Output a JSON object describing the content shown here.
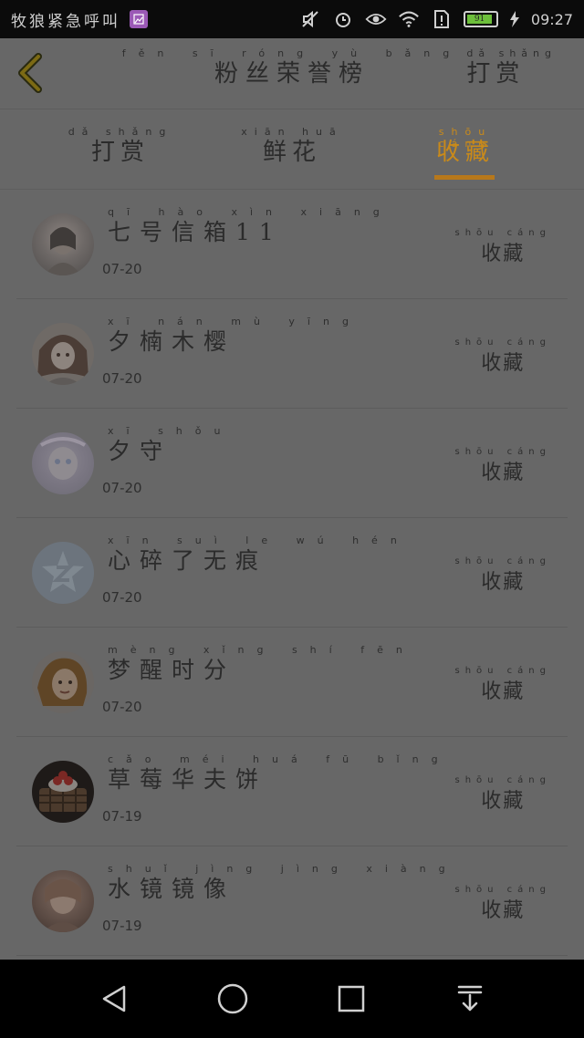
{
  "status_bar": {
    "app_text": "牧狼紧急呼叫",
    "time": "09:27",
    "battery_level": "91",
    "icons": [
      "gallery-icon",
      "mute-icon",
      "alarm-icon",
      "eye-icon",
      "wifi-icon",
      "sim-alert-icon",
      "battery-icon",
      "charging-icon"
    ]
  },
  "header": {
    "back_icon": "chevron-left-icon",
    "title_pinyin": "fěn sī róng yù bǎng",
    "title": "粉丝荣誉榜",
    "reward_pinyin": "dǎ shǎng",
    "reward_label": "打赏"
  },
  "tabs": [
    {
      "pinyin": "dǎ shǎng",
      "label": "打赏",
      "active": false
    },
    {
      "pinyin": "xiān huā",
      "label": "鲜花",
      "active": false
    },
    {
      "pinyin": "shōu cáng",
      "label": "收藏",
      "active": true
    }
  ],
  "rows": [
    {
      "name_pinyin": "qī hào xìn xiāng",
      "name": "七号信箱11",
      "date": "07-20",
      "action_pinyin": "shōu cáng",
      "action": "收藏"
    },
    {
      "name_pinyin": "xī nán mù yīng",
      "name": "夕楠木樱",
      "date": "07-20",
      "action_pinyin": "shōu cáng",
      "action": "收藏"
    },
    {
      "name_pinyin": "xī shǒu",
      "name": "夕守",
      "date": "07-20",
      "action_pinyin": "shōu cáng",
      "action": "收藏"
    },
    {
      "name_pinyin": "xīn suì le wú hén",
      "name": "心碎了无痕",
      "date": "07-20",
      "action_pinyin": "shōu cáng",
      "action": "收藏"
    },
    {
      "name_pinyin": "mèng xǐng shí fēn",
      "name": "梦醒时分",
      "date": "07-20",
      "action_pinyin": "shōu cáng",
      "action": "收藏"
    },
    {
      "name_pinyin": "cǎo méi huá fū bǐng",
      "name": "草莓华夫饼",
      "date": "07-19",
      "action_pinyin": "shōu cáng",
      "action": "收藏"
    },
    {
      "name_pinyin": "shuǐ jìng jìng xiàng",
      "name": "水镜镜像",
      "date": "07-19",
      "action_pinyin": "shōu cáng",
      "action": "收藏"
    }
  ],
  "navbar": {
    "icons": [
      "back-triangle-icon",
      "home-circle-icon",
      "recents-square-icon",
      "notification-pull-icon"
    ]
  },
  "colors": {
    "accent": "#c98a1a",
    "overlay_bg": "#676767"
  }
}
